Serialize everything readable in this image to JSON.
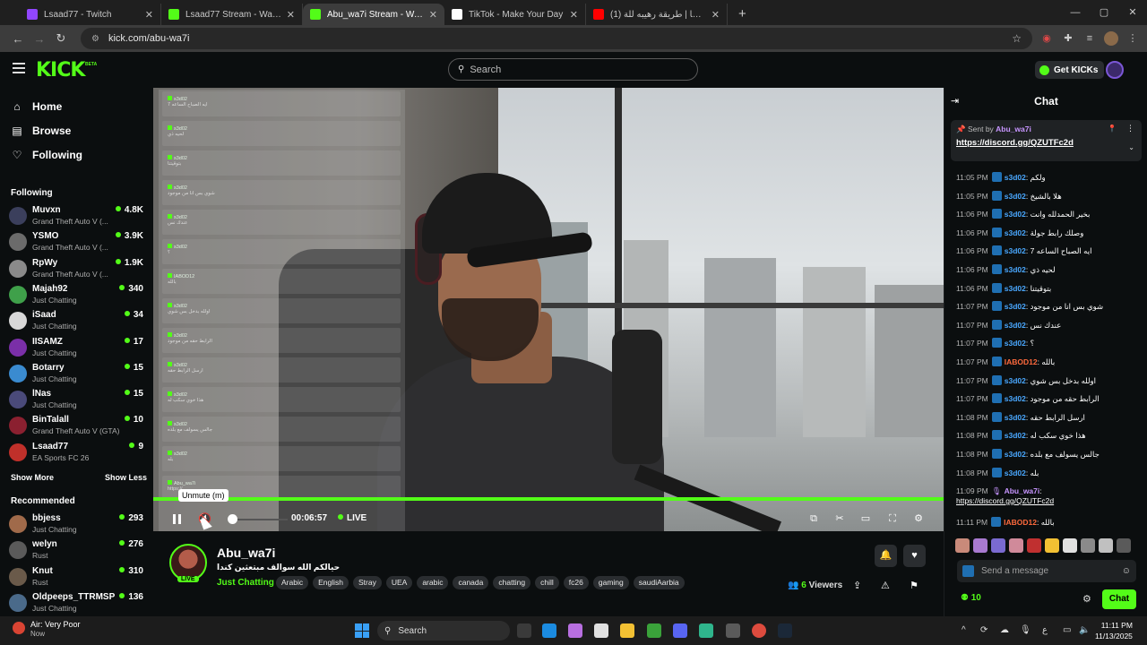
{
  "browser": {
    "tabs": [
      {
        "title": "Lsaad77 - Twitch",
        "color": "#9146ff",
        "active": false
      },
      {
        "title": "Lsaad77 Stream - Watch Live on",
        "color": "#53fc18",
        "active": false
      },
      {
        "title": "Abu_wa7i Stream - Watch Live o",
        "color": "#53fc18",
        "active": true
      },
      {
        "title": "TikTok - Make Your Day",
        "color": "#ffffff",
        "active": false
      },
      {
        "title": "(1) استوكورسا | طريقة رهيبه للة",
        "color": "#ff0000",
        "active": false
      }
    ],
    "url": "kick.com/abu-wa7i"
  },
  "header": {
    "logo": "KICK",
    "beta": "BETA",
    "search_placeholder": "Search",
    "get_kicks": "Get KICKs"
  },
  "sidebar": {
    "nav": [
      {
        "label": "Home",
        "icon": "home-icon",
        "glyph": "⌂"
      },
      {
        "label": "Browse",
        "icon": "browse-icon",
        "glyph": "▤"
      },
      {
        "label": "Following",
        "icon": "heart-icon",
        "glyph": "♡"
      }
    ],
    "following_heading": "Following",
    "following": [
      {
        "name": "Muvxn",
        "game": "Grand Theft Auto V (...",
        "viewers": "4.8K",
        "color": "#3b3f5c"
      },
      {
        "name": "YSMO",
        "game": "Grand Theft Auto V (...",
        "viewers": "3.9K",
        "color": "#6b6b6b"
      },
      {
        "name": "RpWy",
        "game": "Grand Theft Auto V (...",
        "viewers": "1.9K",
        "color": "#8a8a8a"
      },
      {
        "name": "Majah92",
        "game": "Just Chatting",
        "viewers": "340",
        "color": "#3fa04a"
      },
      {
        "name": "iSaad",
        "game": "Just Chatting",
        "viewers": "34",
        "color": "#d8d8d8"
      },
      {
        "name": "IISAMZ",
        "game": "Just Chatting",
        "viewers": "17",
        "color": "#7a2fa8"
      },
      {
        "name": "Botarry",
        "game": "Just Chatting",
        "viewers": "15",
        "color": "#3a8bd0"
      },
      {
        "name": "lNas",
        "game": "Just Chatting",
        "viewers": "15",
        "color": "#4a4a7a"
      },
      {
        "name": "BinTalall",
        "game": "Grand Theft Auto V (GTA)",
        "viewers": "10",
        "color": "#8b2030"
      },
      {
        "name": "Lsaad77",
        "game": "EA Sports FC 26",
        "viewers": "9",
        "color": "#c0302a"
      }
    ],
    "show_more": "Show More",
    "show_less": "Show Less",
    "recommended_heading": "Recommended",
    "recommended": [
      {
        "name": "bbjess",
        "game": "Just Chatting",
        "viewers": "293",
        "color": "#a06a4a"
      },
      {
        "name": "welyn",
        "game": "Rust",
        "viewers": "276",
        "color": "#5a5a5a"
      },
      {
        "name": "Knut",
        "game": "Rust",
        "viewers": "310",
        "color": "#6a5a4a"
      },
      {
        "name": "Oldpeeps_TTRMSP",
        "game": "Just Chatting",
        "viewers": "136",
        "color": "#4a6a8a"
      }
    ]
  },
  "player": {
    "overlay_chat": [
      {
        "user": "s3d02",
        "text": "ايه الصباح الساعه 7"
      },
      {
        "user": "s3d02",
        "text": "لحيه ذي"
      },
      {
        "user": "s3d02",
        "text": "بتوقيتنا"
      },
      {
        "user": "s3d02",
        "text": "شوي بس انا من موجود"
      },
      {
        "user": "s3d02",
        "text": "عندك نس"
      },
      {
        "user": "s3d02",
        "text": "؟"
      },
      {
        "user": "IABOD12",
        "text": "بالله"
      },
      {
        "user": "s3d02",
        "text": "اولله بدخل بس شوي"
      },
      {
        "user": "s3d02",
        "text": "الرابط حقه من موجود"
      },
      {
        "user": "s3d02",
        "text": "ارسل الرابط حقه"
      },
      {
        "user": "s3d02",
        "text": "هذا خوي سكب له"
      },
      {
        "user": "s3d02",
        "text": "جالس يسولف مع بلده"
      },
      {
        "user": "s3d02",
        "text": "بله"
      },
      {
        "user": "Abu_wa7i",
        "text": "https://..."
      }
    ],
    "tooltip": "Unmute (m)",
    "time": "00:06:57",
    "live": "LIVE",
    "volume": 0
  },
  "stream": {
    "name": "Abu_wa7i",
    "title": "حيالكم الله سوالف مبتعثين كندا",
    "category": "Just Chatting",
    "live_badge": "LIVE",
    "tags": [
      "Arabic",
      "English",
      "Stray",
      "UEA",
      "arabic",
      "canada",
      "chatting",
      "chill",
      "fc26",
      "gaming",
      "saudiAarbia"
    ],
    "viewers_count": "6",
    "viewers_label": "Viewers"
  },
  "chat": {
    "title": "Chat",
    "pinned_by_label": "Sent by",
    "pinned_by_user": "Abu_wa7i",
    "pinned_link": "https://discord.gg/QZUTFc2d",
    "messages": [
      {
        "time": "11:05 PM",
        "user": "s3d02",
        "text": "ولكم",
        "ucolor": "#4aa8ff"
      },
      {
        "time": "11:05 PM",
        "user": "s3d02",
        "text": "هلا بالشيخ",
        "ucolor": "#4aa8ff"
      },
      {
        "time": "11:06 PM",
        "user": "s3d02",
        "text": "بخير الحمدلله وانت",
        "ucolor": "#4aa8ff"
      },
      {
        "time": "11:06 PM",
        "user": "s3d02",
        "text": "وصلك رابط جولة",
        "ucolor": "#4aa8ff"
      },
      {
        "time": "11:06 PM",
        "user": "s3d02",
        "text": "ايه الصباح الساعه 7",
        "ucolor": "#4aa8ff"
      },
      {
        "time": "11:06 PM",
        "user": "s3d02",
        "text": "لحيه ذي",
        "ucolor": "#4aa8ff"
      },
      {
        "time": "11:06 PM",
        "user": "s3d02",
        "text": "بتوقيتنا",
        "ucolor": "#4aa8ff"
      },
      {
        "time": "11:07 PM",
        "user": "s3d02",
        "text": "شوي بس انا من موجود",
        "ucolor": "#4aa8ff"
      },
      {
        "time": "11:07 PM",
        "user": "s3d02",
        "text": "عندك نس",
        "ucolor": "#4aa8ff"
      },
      {
        "time": "11:07 PM",
        "user": "s3d02",
        "text": "؟",
        "ucolor": "#4aa8ff"
      },
      {
        "time": "11:07 PM",
        "user": "IABOD12",
        "text": "بالله",
        "ucolor": "#ff6a3d"
      },
      {
        "time": "11:07 PM",
        "user": "s3d02",
        "text": "اولله بدخل بس شوي",
        "ucolor": "#4aa8ff"
      },
      {
        "time": "11:07 PM",
        "user": "s3d02",
        "text": "الرابط حقه من موجود",
        "ucolor": "#4aa8ff"
      },
      {
        "time": "11:08 PM",
        "user": "s3d02",
        "text": "ارسل الرابط حقه",
        "ucolor": "#4aa8ff"
      },
      {
        "time": "11:08 PM",
        "user": "s3d02",
        "text": "هذا خوي سكب له",
        "ucolor": "#4aa8ff"
      },
      {
        "time": "11:08 PM",
        "user": "s3d02",
        "text": "جالس يسولف مع بلده",
        "ucolor": "#4aa8ff"
      },
      {
        "time": "11:08 PM",
        "user": "s3d02",
        "text": "بله",
        "ucolor": "#4aa8ff"
      }
    ],
    "streamer_msg": {
      "time": "11:09 PM",
      "user": "Abu_wa7i",
      "link": "https://discord.gg/QZUTFc2d"
    },
    "last_msg": {
      "time": "11:11 PM",
      "user": "IABOD12",
      "text": "بالله"
    },
    "send_placeholder": "Send a message",
    "kicks": "10",
    "chat_button": "Chat"
  },
  "taskbar": {
    "weather_title": "Air: Very Poor",
    "weather_sub": "Now",
    "search": "Search",
    "time": "11:11 PM",
    "date": "11/13/2025"
  }
}
